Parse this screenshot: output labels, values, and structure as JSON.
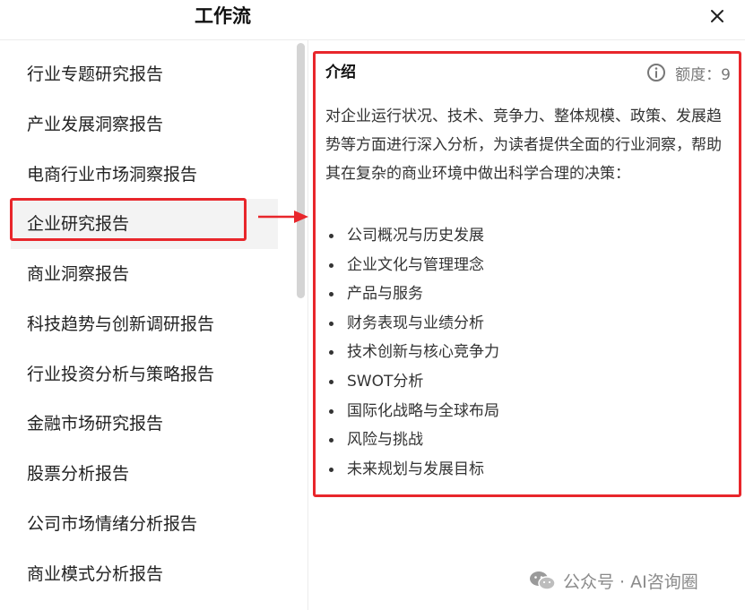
{
  "header": {
    "title": "工作流"
  },
  "sidebar": {
    "items": [
      {
        "label": "行业专题研究报告"
      },
      {
        "label": "产业发展洞察报告"
      },
      {
        "label": "电商行业市场洞察报告"
      },
      {
        "label": "企业研究报告"
      },
      {
        "label": "商业洞察报告"
      },
      {
        "label": "科技趋势与创新调研报告"
      },
      {
        "label": "行业投资分析与策略报告"
      },
      {
        "label": "金融市场研究报告"
      },
      {
        "label": "股票分析报告"
      },
      {
        "label": "公司市场情绪分析报告"
      },
      {
        "label": "商业模式分析报告"
      }
    ],
    "active_label": "企业研究报告"
  },
  "detail": {
    "title": "介绍",
    "quota_label": "额度：9",
    "description": "对企业运行状况、技术、竞争力、整体规模、政策、发展趋势等方面进行深入分析，为读者提供全面的行业洞察，帮助其在复杂的商业环境中做出科学合理的决策：",
    "bullets": [
      "公司概况与历史发展",
      "企业文化与管理理念",
      "产品与服务",
      "财务表现与业绩分析",
      "技术创新与核心竞争力",
      "SWOT分析",
      "国际化战略与全球布局",
      "风险与挑战",
      "未来规划与发展目标"
    ]
  },
  "watermark": {
    "text": "公众号 · AI咨询圈"
  },
  "colors": {
    "highlight": "#e8262b",
    "active_bg": "#f3f3f3",
    "muted": "#777777"
  },
  "icons": {
    "close": "close-icon",
    "info": "info-icon",
    "arrow": "arrow-right-icon",
    "wechat": "wechat-icon"
  }
}
